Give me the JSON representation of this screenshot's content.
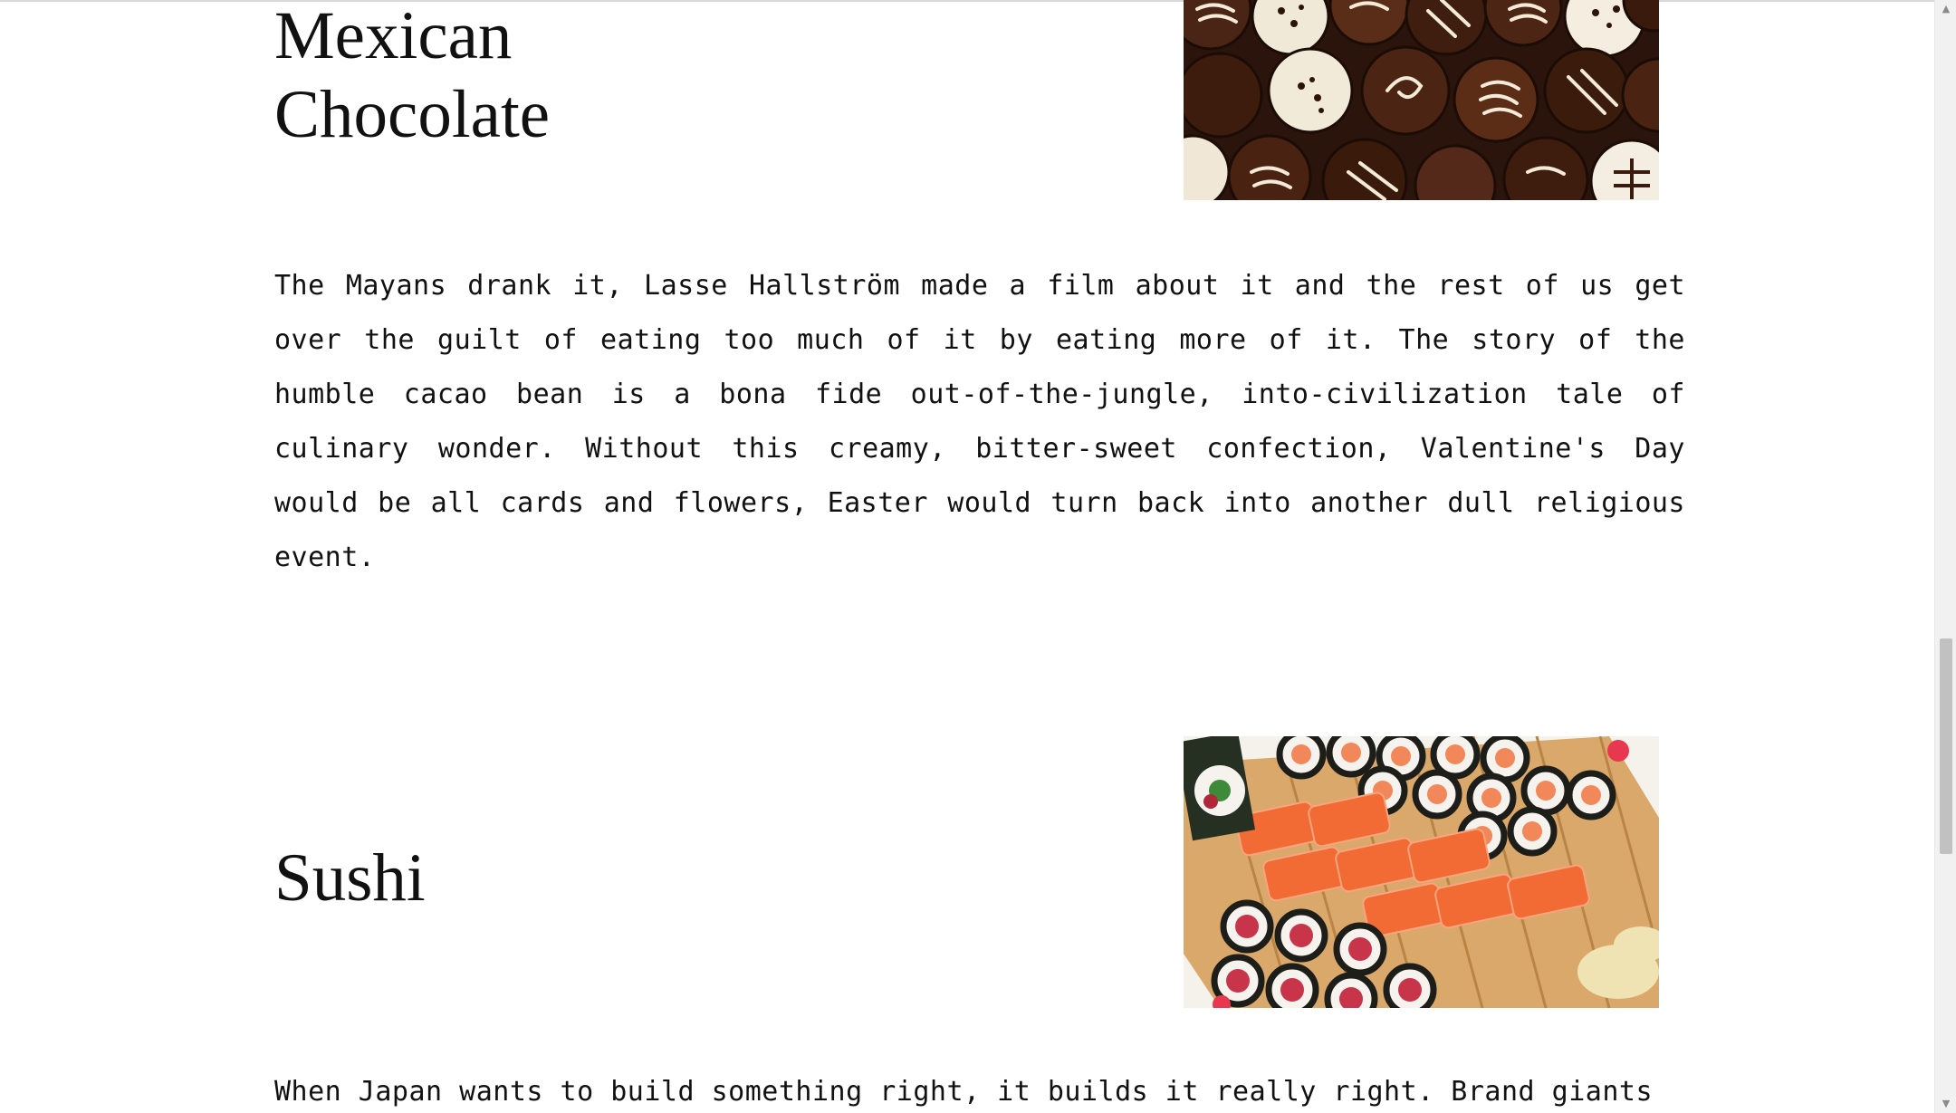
{
  "sections": [
    {
      "title_line1": "Mexican",
      "title_line2": "Chocolate",
      "image": "chocolate-truffles-photo",
      "description": "The Mayans drank it, Lasse Hallström made a film about it and the rest of us get over the guilt of eating too much of it by eating more of it. The story of the humble cacao bean is a bona fide out-of-the-jungle, into-civilization tale of culinary wonder. Without this creamy, bitter-sweet confection, Valentine's Day would be all cards and flowers, Easter would turn back into another dull religious event."
    },
    {
      "title": "Sushi",
      "image": "sushi-platter-photo",
      "description": "When Japan wants to build something right, it builds it really right. Brand giants"
    }
  ],
  "scrollbar": {
    "up_icon": "▲",
    "down_icon": "▼",
    "position": 0.62
  },
  "colors": {
    "text": "#111111",
    "background": "#ffffff",
    "scroll_track": "#f1f1f1",
    "scroll_thumb": "#c1c1c1"
  }
}
